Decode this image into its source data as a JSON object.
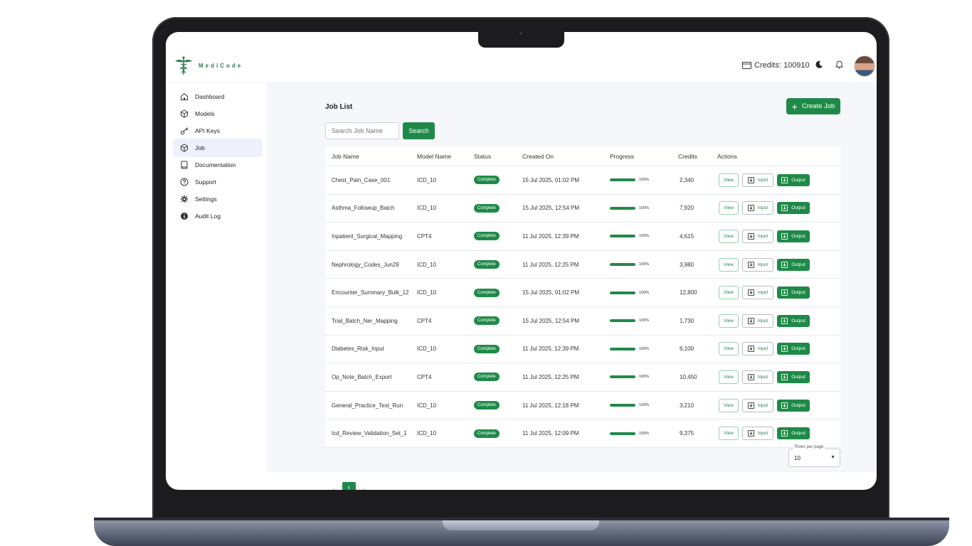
{
  "app": {
    "name": "MediCode"
  },
  "header": {
    "credits_label": "Credits: 100910"
  },
  "sidebar": {
    "items": [
      {
        "label": "Dashboard",
        "icon": "home-icon"
      },
      {
        "label": "Models",
        "icon": "cube-icon"
      },
      {
        "label": "API Keys",
        "icon": "key-icon"
      },
      {
        "label": "Job",
        "icon": "box-icon",
        "active": true
      },
      {
        "label": "Documentation",
        "icon": "book-icon"
      },
      {
        "label": "Support",
        "icon": "help-circle-icon"
      },
      {
        "label": "Settings",
        "icon": "gear-icon"
      },
      {
        "label": "Audit Log",
        "icon": "info-icon"
      }
    ]
  },
  "main": {
    "title": "Job List",
    "create_label": "Create Job",
    "search": {
      "placeholder": "Search Job Name",
      "value": "",
      "button_label": "Search"
    }
  },
  "table": {
    "columns": [
      "Job Name",
      "Model Name",
      "Status",
      "Created On",
      "Progress",
      "Credits",
      "Actions"
    ],
    "action_labels": {
      "view": "View",
      "input": "Input",
      "output": "Output"
    },
    "rows": [
      {
        "name": "Chest_Pain_Case_001",
        "model": "ICD_10",
        "status": "Complete",
        "created": "15 Jul 2025, 01:02 PM",
        "progress": 100,
        "progress_label": "100%",
        "credits": "2,340"
      },
      {
        "name": "Asthma_Followup_Batch",
        "model": "ICD_10",
        "status": "Complete",
        "created": "15 Jul 2025, 12:54 PM",
        "progress": 100,
        "progress_label": "100%",
        "credits": "7,920"
      },
      {
        "name": "Inpatient_Surgical_Mapping",
        "model": "CPT4",
        "status": "Complete",
        "created": "11 Jul 2025, 12:39 PM",
        "progress": 100,
        "progress_label": "100%",
        "credits": "4,615"
      },
      {
        "name": "Nephrology_Codes_Jun29",
        "model": "ICD_10",
        "status": "Complete",
        "created": "11 Jul 2025, 12:25 PM",
        "progress": 100,
        "progress_label": "100%",
        "credits": "3,980"
      },
      {
        "name": "Encounter_Summary_Bulk_12",
        "model": "ICD_10",
        "status": "Complete",
        "created": "15 Jul 2025, 01:02 PM",
        "progress": 100,
        "progress_label": "100%",
        "credits": "12,800"
      },
      {
        "name": "Trial_Batch_Ner_Mapping",
        "model": "CPT4",
        "status": "Complete",
        "created": "15 Jul 2025, 12:54 PM",
        "progress": 100,
        "progress_label": "100%",
        "credits": "1,730"
      },
      {
        "name": "Diabetes_Risk_Input",
        "model": "ICD_10",
        "status": "Complete",
        "created": "11 Jul 2025, 12:39 PM",
        "progress": 100,
        "progress_label": "100%",
        "credits": "6,100"
      },
      {
        "name": "Op_Note_Batch_Export",
        "model": "CPT4",
        "status": "Complete",
        "created": "11 Jul 2025, 12:25 PM",
        "progress": 100,
        "progress_label": "100%",
        "credits": "10,450"
      },
      {
        "name": "General_Practice_Test_Run",
        "model": "ICD_10",
        "status": "Complete",
        "created": "11 Jul 2025, 12:18 PM",
        "progress": 100,
        "progress_label": "100%",
        "credits": "3,210"
      },
      {
        "name": "Icd_Review_Validation_Set_1",
        "model": "ICD_10",
        "status": "Complete",
        "created": "11 Jul 2025, 12:09 PM",
        "progress": 100,
        "progress_label": "100%",
        "credits": "9,375"
      }
    ]
  },
  "pagination": {
    "current_page": "1",
    "prev": "‹",
    "next": "›",
    "rows_per_page_label": "Rows per page",
    "rows_per_page": "10"
  },
  "colors": {
    "brand": "#1f8a48",
    "active_nav": "#eef1fb",
    "main_bg": "#f6f7fb"
  }
}
